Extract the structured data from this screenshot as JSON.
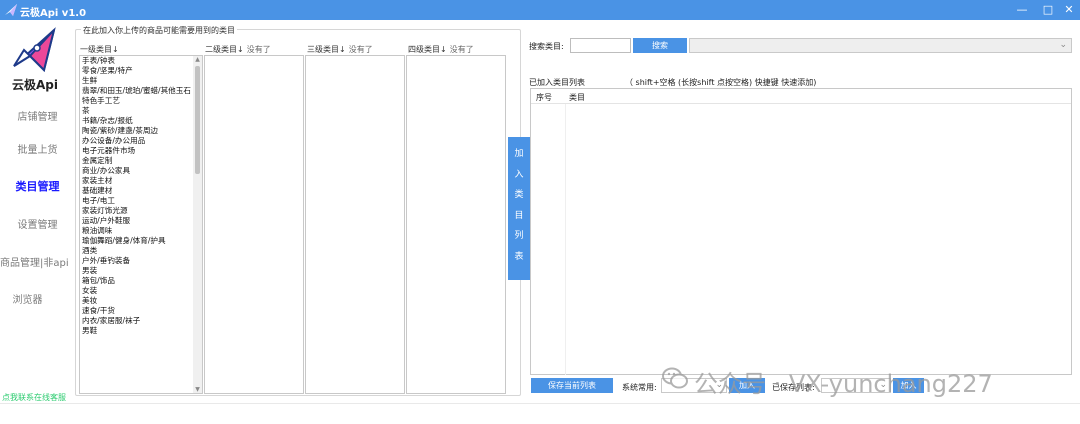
{
  "window": {
    "title": "云极Api v1.0",
    "minimize": "—",
    "maximize": "□",
    "close": "✕",
    "accent": "#4a93e5"
  },
  "sidebar": {
    "brand": "云极Api",
    "items": [
      {
        "label": "店铺管理",
        "active": false
      },
      {
        "label": "批量上货",
        "active": false
      },
      {
        "label": "类目管理",
        "active": true
      },
      {
        "label": "设置管理",
        "active": false
      },
      {
        "label": "商品管理|非api",
        "active": false
      },
      {
        "label": "浏览器",
        "active": false
      }
    ],
    "contact": "点我联系在线客服"
  },
  "categories": {
    "group_title": "在此加入你上传的商品可能需要用到的类目",
    "level1_header": "一级类目↓",
    "level2_header": "二级类目↓",
    "level3_header": "三级类目↓",
    "level4_header": "四级类目↓",
    "none_text": "没有了",
    "level1_items": [
      "手表/钟表",
      "零食/坚果/特产",
      "生鲜",
      "翡翠/和田玉/琥珀/蜜蜡/其他玉石",
      "特色手工艺",
      "茶",
      "书籍/杂志/报纸",
      "陶瓷/紫砂/建盏/茶周边",
      "办公设备/办公用品",
      "电子元器件市场",
      "金属定制",
      "商业/办公家具",
      "家装主材",
      "基础建材",
      "电子/电工",
      "家装灯饰光源",
      "运动/户外鞋服",
      "粮油调味",
      "瑜伽舞蹈/健身/体育/护具",
      "酒类",
      "户外/垂钓装备",
      "男装",
      "箱包/饰品",
      "女装",
      "美妆",
      "速食/干货",
      "内衣/家居服/袜子",
      "男鞋"
    ],
    "add_button": "加入类目列表"
  },
  "search": {
    "label": "搜索类目:",
    "input_value": "",
    "button": "搜索",
    "dropdown_value": ""
  },
  "added": {
    "label": "已加入类目列表",
    "hint": "（  shift+空格  (长按shift 点按空格)  快捷键 快速添加)",
    "columns": [
      "序号",
      "类目"
    ],
    "rows": []
  },
  "footer": {
    "save_button": "保存当前列表",
    "system_label": "系统常用:",
    "system_value": "",
    "add_button_1": "加入",
    "saved_label": "已保存列表:",
    "saved_value": "",
    "add_button_2": "加入"
  },
  "watermark": {
    "text": "公众号 · VX-yunchang227"
  }
}
